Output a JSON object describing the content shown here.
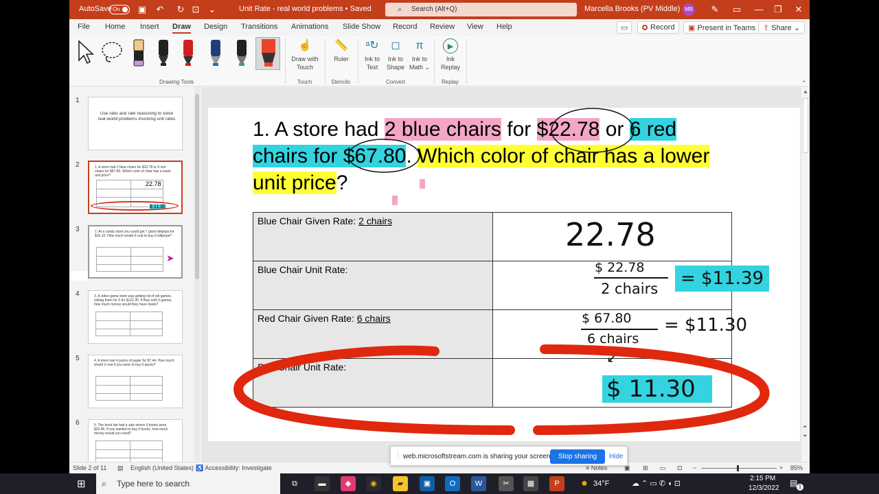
{
  "titlebar": {
    "autosave_label": "AutoSave",
    "autosave_state": "On",
    "doc_title": "Unit Rate - real world problems • Saved",
    "search_placeholder": "Search (Alt+Q)",
    "user_name": "Marcella Brooks (PV Middle)",
    "user_initials": "MB"
  },
  "menu": {
    "items": [
      "File",
      "Home",
      "Insert",
      "Draw",
      "Design",
      "Transitions",
      "Animations",
      "Slide Show",
      "Record",
      "Review",
      "View",
      "Help"
    ],
    "active": "Draw",
    "record_btn": "Record",
    "present_btn": "Present in Teams",
    "share_btn": "Share"
  },
  "ribbon": {
    "drawing_tools_label": "Drawing Tools",
    "draw_with_touch_1": "Draw with",
    "draw_with_touch_2": "Touch",
    "touch_label": "Touch",
    "ruler": "Ruler",
    "stencils_label": "Stencils",
    "ink_to_text_1": "Ink to",
    "ink_to_text_2": "Text",
    "ink_to_shape_1": "Ink to",
    "ink_to_shape_2": "Shape",
    "ink_to_math_1": "Ink to",
    "ink_to_math_2": "Math",
    "convert_label": "Convert",
    "ink_replay_1": "Ink",
    "ink_replay_2": "Replay",
    "replay_label": "Replay",
    "pen_colors": [
      "#222222",
      "#d21f1f",
      "#1e6fb0",
      "#4b8f9a",
      "#e8452a"
    ]
  },
  "thumbnails": [
    {
      "num": "1",
      "text": "Use ratio and rate reasoning to solve real-world problems involving unit rates"
    },
    {
      "num": "2",
      "text": "1. A store had 2 blue chairs for $22.78 or 6 red chairs for $67.80. Which color of chair has a lower unit price?",
      "extra": "22.78",
      "extra2": "$ 11.30"
    },
    {
      "num": "3",
      "text": "2. At a candy store you could get 7 giant lollipops for $16.10. How much would it cost to buy 6 lollipops?"
    },
    {
      "num": "4",
      "text": "3. A video game store was getting rid of old games, selling them for 5 for $122.35. If they sold 3 games, how much money would they have made?"
    },
    {
      "num": "5",
      "text": "4. A store had 4 packs of paper for $7.44. How much would it cost if you were to buy 5 packs?"
    },
    {
      "num": "6",
      "text": "5. The book fair had a sale where 5 books were $25.85. If you wanted to buy 6 books, how much money would you need?"
    }
  ],
  "slide": {
    "q_num": "1. A store had ",
    "q_p1": "2 blue chairs",
    "q_p2": " for ",
    "q_p3": "$22.78",
    "q_p4": " or ",
    "q_p5": "6 red",
    "q_p6": "chairs for ",
    "q_p7": "$67.80",
    "q_p8": ". ",
    "q_p9": "Which color of chair has a lower",
    "q_p10": "unit price",
    "q_p11": "?",
    "rows": [
      {
        "label": "Blue Chair Given Rate: ",
        "underlined": "2 chairs"
      },
      {
        "label": "Blue Chair Unit Rate:"
      },
      {
        "label": "Red Chair Given Rate: ",
        "underlined": "6 chairs"
      },
      {
        "label": "Red Chair Unit Rate:"
      }
    ],
    "hw_1": "22.78",
    "hw_2_num": "$ 22.78",
    "hw_2_den": "2 chairs",
    "hw_2_res": "= $11.39",
    "hw_3_num": "$ 67.80",
    "hw_3_den": "6 chairs",
    "hw_3_res": "= $11.30",
    "hw_4": "$ 11.30"
  },
  "status": {
    "slide_info": "Slide 2 of 11",
    "language": "English (United States)",
    "accessibility": "Accessibility: Investigate",
    "notes": "Notes",
    "zoom": "85%"
  },
  "sharebar": {
    "message": "web.microsoftstream.com is sharing your screen.",
    "stop": "Stop sharing",
    "hide": "Hide"
  },
  "taskbar": {
    "search_placeholder": "Type here to search",
    "weather": "34°F",
    "time": "2:15 PM",
    "date": "12/3/2022",
    "notif_count": "1"
  }
}
